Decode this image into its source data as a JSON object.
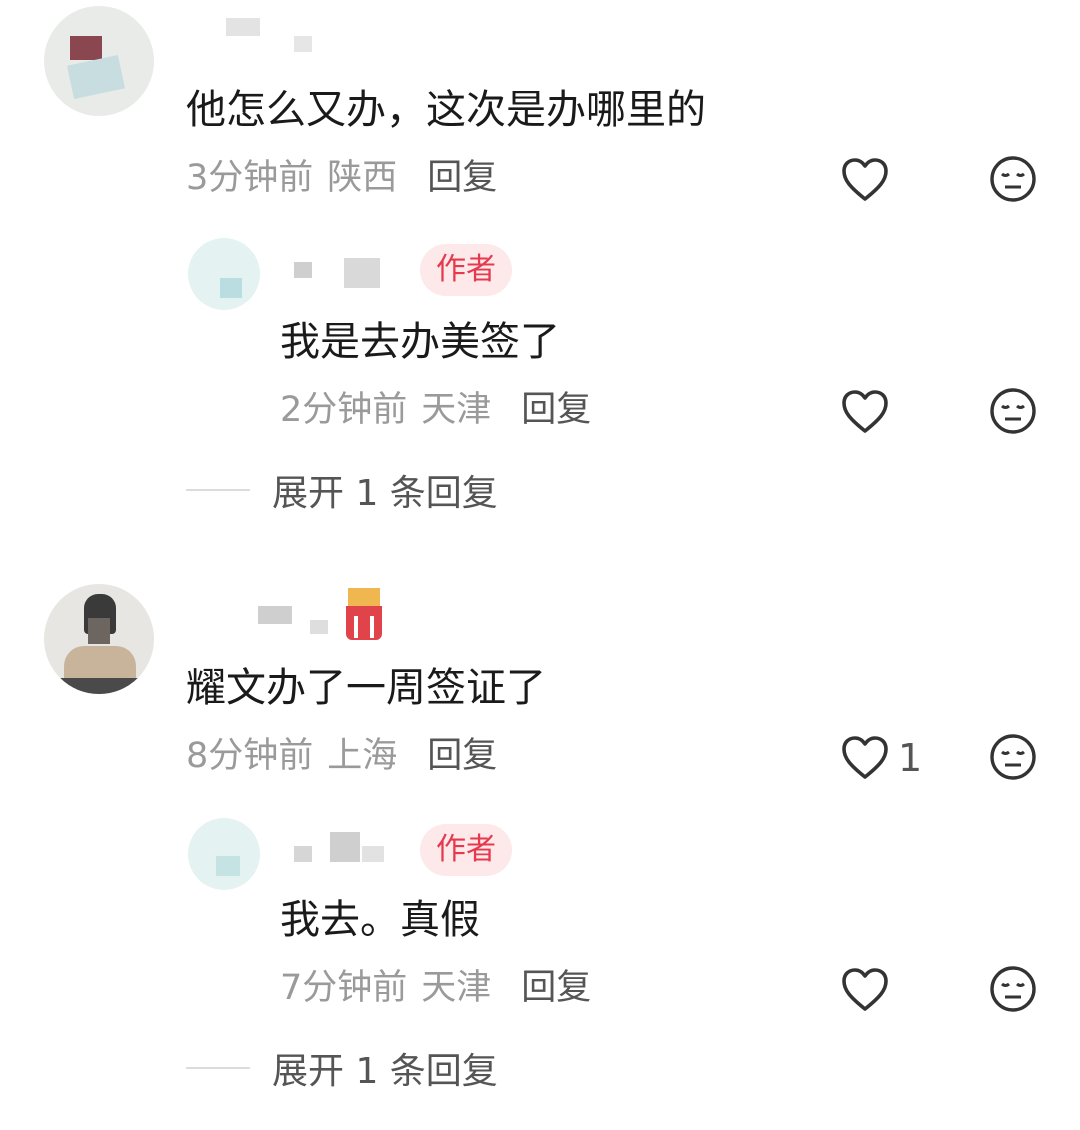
{
  "comments": [
    {
      "text": "他怎么又办，这次是办哪里的",
      "time": "3分钟前",
      "location": "陕西",
      "reply_label": "回复",
      "like_icon": "heart-outline-icon",
      "dislike_icon": "meh-face-icon",
      "reply": {
        "badge": "作者",
        "text": "我是去办美签了",
        "time": "2分钟前",
        "location": "天津",
        "reply_label": "回复"
      },
      "expand_label": "展开 1 条回复"
    },
    {
      "text": "耀文办了一周签证了",
      "time": "8分钟前",
      "location": "上海",
      "reply_label": "回复",
      "like_count": "1",
      "reply": {
        "badge": "作者",
        "text": "我去。真假",
        "time": "7分钟前",
        "location": "天津",
        "reply_label": "回复"
      },
      "expand_label": "展开 1 条回复"
    }
  ],
  "colors": {
    "author_badge_bg": "#fde8ea",
    "author_badge_text": "#e6394d",
    "meta_text": "#9a9a9a"
  }
}
